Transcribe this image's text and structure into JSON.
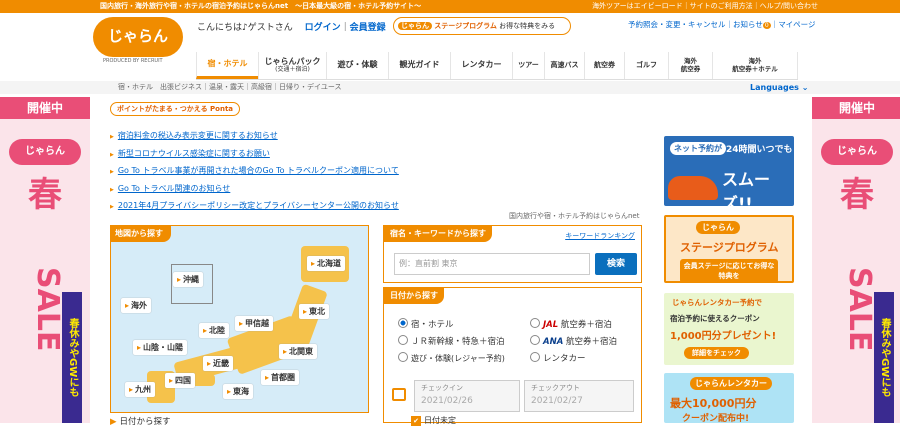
{
  "topbar": {
    "left": "国内旅行・海外旅行や宿・ホテルの宿泊予約はじゃらんnet　〜日本最大級の宿・ホテル予約サイト〜",
    "right": "海外ツアーはエイビーロード｜サイトのご利用方法｜ヘルプ/問い合わせ"
  },
  "logo": {
    "text": "じゃらん",
    "sub": "PRODUCED BY RECRUIT"
  },
  "header": {
    "greeting": "こんにちは♪ゲストさん",
    "login": "ログイン",
    "register": "会員登録",
    "stage_tag": "じゃらん",
    "stage_label": "ステージプログラム",
    "stage_text": "お得な特典をみる",
    "reservation": "予約照会・変更・キャンセル",
    "notice": "お知らせ",
    "notice_count": "0",
    "mypage": "マイページ"
  },
  "nav": [
    {
      "label": "宿・ホテル"
    },
    {
      "label": "じゃらんパック",
      "sub": "(交通＋宿泊)"
    },
    {
      "label": "遊び・体験"
    },
    {
      "label": "観光ガイド"
    },
    {
      "label": "レンタカー"
    },
    {
      "label": "ツアー"
    },
    {
      "label": "高速バス"
    },
    {
      "label": "航空券"
    },
    {
      "label": "ゴルフ"
    },
    {
      "label": "海外",
      "sub": "航空券"
    },
    {
      "label": "海外",
      "sub": "航空券＋ホテル"
    }
  ],
  "subnav": {
    "items": "宿・ホテル　出張ビジネス｜温泉・露天｜高級宿｜日帰り・デイユース",
    "languages": "Languages"
  },
  "banner_left": {
    "head": "開催中",
    "badge": "じゃらん",
    "spring": "春",
    "sale": "SALE",
    "vert": "春休みやGWにも"
  },
  "banner_right": {
    "head": "開催中",
    "badge": "じゃらん",
    "spring": "春",
    "sale": "SALE",
    "vert": "春休みやGWにも"
  },
  "ponta": "ポイントがたまる・つかえる Ponta",
  "news": [
    "宿泊料金の税込み表示変更に関するお知らせ",
    "新型コロナウイルス感染症に関するお願い",
    "Go To トラベル事業が再開された場合のGo To トラベルクーポン適用について",
    "Go To トラベル関連のお知らせ",
    "2021年4月プライバシーポリシー改定とプライバシーセンター公開のお知らせ"
  ],
  "caption": "国内旅行や宿・ホテル予約はじゃらんnet",
  "map": {
    "header": "地図から探す",
    "regions": [
      "沖縄",
      "北海道",
      "海外",
      "東北",
      "北陸",
      "甲信越",
      "山陰・山陽",
      "北関東",
      "近畿",
      "九州",
      "四国",
      "東海",
      "首都圏"
    ]
  },
  "keyword": {
    "header": "宿名・キーワードから探す",
    "ranking": "キーワードランキング",
    "placeholder": "例：直前割 東京",
    "button": "検索"
  },
  "date": {
    "header": "日付から探す",
    "options": [
      "宿・ホテル",
      "航空券＋宿泊",
      "ＪＲ新幹線・特急＋宿泊",
      "航空券＋宿泊",
      "遊び・体験(レジャー予約)",
      "レンタカー"
    ],
    "jal": "JAL",
    "ana": "ANA",
    "checkin_label": "チェックイン",
    "checkin": "2021/02/26",
    "checkout_label": "チェックアウト",
    "checkout": "2021/02/27",
    "undecided": "日付未定"
  },
  "bottom_link": "日付から探す",
  "ads": [
    {
      "a": "ネット予約が",
      "b": "24時間いつでも",
      "c": "スムーズ!!"
    },
    {
      "a": "じゃらん",
      "b": "ステージプログラム",
      "c": "会員ステージに応じてお得な特典を"
    },
    {
      "a": "じゃらんレンタカー予約で",
      "b": "宿泊予約に使えるクーポン",
      "c": "1,000円分プレゼント!",
      "d": "詳細をチェック"
    },
    {
      "a": "じゃらんレンタカー",
      "b": "最大10,000円分",
      "c": "クーポン配布中!"
    }
  ]
}
